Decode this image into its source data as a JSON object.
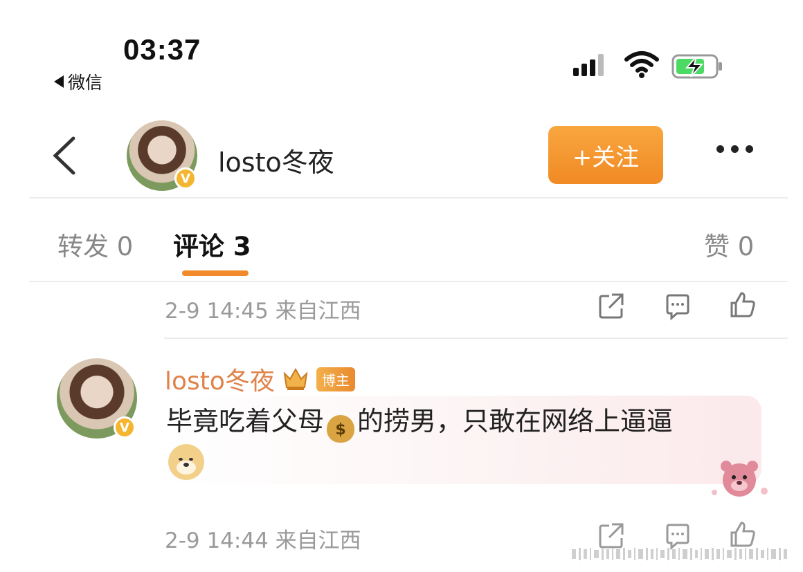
{
  "status_bar": {
    "time": "03:37",
    "back_app": "微信"
  },
  "header": {
    "username": "losto冬夜",
    "follow_label": "+关注",
    "verified_mark": "V"
  },
  "tabs": [
    {
      "label": "转发 0"
    },
    {
      "label": "评论 3"
    },
    {
      "label": "赞 0"
    }
  ],
  "comments": [
    {
      "meta": "2-9 14:45 来自江西"
    },
    {
      "author": "losto冬夜",
      "tag": "博主",
      "text_before": "毕竟吃着父母",
      "money_glyph": "$",
      "text_after": "的捞男，只敢在网络上逼逼",
      "meta": "2-9 14:44 来自江西"
    }
  ],
  "colors": {
    "accent": "#f18a2a",
    "follow_bg": "#f39a33",
    "name_orange": "#e0834a",
    "badge_gold": "#f4b630"
  }
}
